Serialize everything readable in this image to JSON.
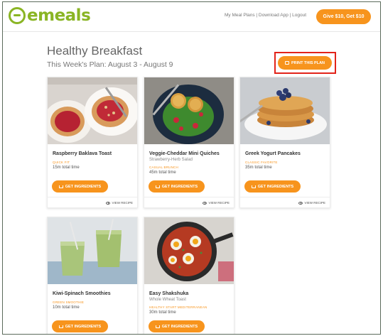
{
  "brand": {
    "name": "emeals",
    "color": "#8ab524"
  },
  "accent": "#f7941d",
  "highlight": "#e2231a",
  "nav": {
    "links": "My Meal Plans | Download App | Logout",
    "give_button": "Give $10, Get $10"
  },
  "page": {
    "title": "Healthy Breakfast",
    "subtitle": "This Week's Plan: August 3 - August 9",
    "print_button": "PRINT THIS PLAN"
  },
  "card_labels": {
    "ingredients": "GET INGREDIENTS",
    "view_recipe": "VIEW RECIPE"
  },
  "recipes": [
    {
      "name": "Raspberry Baklava Toast",
      "side": "",
      "tag": "QUICK FIT",
      "time": "15m total time"
    },
    {
      "name": "Veggie-Cheddar Mini Quiches",
      "side": "Strawberry-Herb Salad",
      "tag": "CASUAL BRUNCH",
      "time": "45m total time"
    },
    {
      "name": "Greek Yogurt Pancakes",
      "side": "",
      "tag": "CLASSIC FAVORITE",
      "time": "35m total time"
    },
    {
      "name": "Kiwi-Spinach Smoothies",
      "side": "",
      "tag": "GREEN SMOOTHIE",
      "time": "10m total time"
    },
    {
      "name": "Easy Shakshuka",
      "side": "Whole Wheat Toast",
      "tag": "HEALTHY START MEDITERRANEAN",
      "time": "30m total time"
    }
  ]
}
